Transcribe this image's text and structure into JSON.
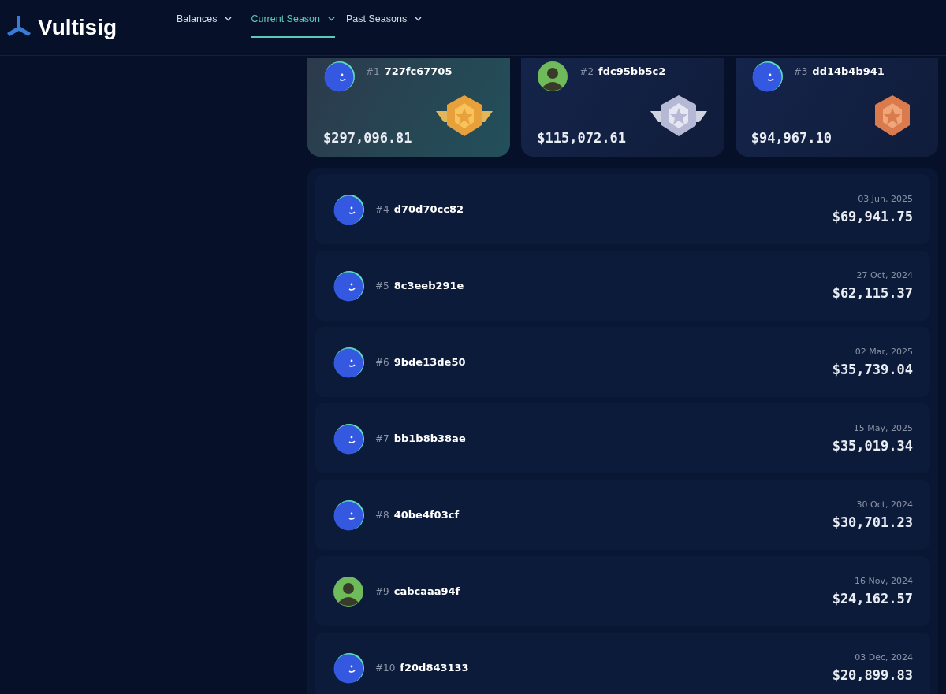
{
  "brand": {
    "name": "Vultisig"
  },
  "nav": [
    {
      "label": "Balances",
      "selected": false
    },
    {
      "label": "Current Season",
      "selected": true
    },
    {
      "label": "Past Seasons",
      "selected": false
    }
  ],
  "podium": [
    {
      "rank": "#1",
      "name": "727fc67705",
      "amount": "$297,096.81",
      "avatar": {
        "kind": "smiley"
      },
      "medal": {
        "kind": "gold"
      }
    },
    {
      "rank": "#2",
      "name": "fdc95bb5c2",
      "amount": "$115,072.61",
      "avatar": {
        "kind": "person"
      },
      "medal": {
        "kind": "silver"
      }
    },
    {
      "rank": "#3",
      "name": "dd14b4b941",
      "amount": "$94,967.10",
      "avatar": {
        "kind": "smiley"
      },
      "medal": {
        "kind": "bronze"
      }
    }
  ],
  "leaderboard": [
    {
      "rank": "#4",
      "name": "d70d70cc82",
      "date": "03 Jun, 2025",
      "amount": "$69,941.75",
      "avatar": {
        "kind": "smiley"
      }
    },
    {
      "rank": "#5",
      "name": "8c3eeb291e",
      "date": "27 Oct, 2024",
      "amount": "$62,115.37",
      "avatar": {
        "kind": "smiley"
      }
    },
    {
      "rank": "#6",
      "name": "9bde13de50",
      "date": "02 Mar, 2025",
      "amount": "$35,739.04",
      "avatar": {
        "kind": "smiley"
      }
    },
    {
      "rank": "#7",
      "name": "bb1b8b38ae",
      "date": "15 May, 2025",
      "amount": "$35,019.34",
      "avatar": {
        "kind": "smiley"
      }
    },
    {
      "rank": "#8",
      "name": "40be4f03cf",
      "date": "30 Oct, 2024",
      "amount": "$30,701.23",
      "avatar": {
        "kind": "smiley"
      }
    },
    {
      "rank": "#9",
      "name": "cabcaaa94f",
      "date": "16 Nov, 2024",
      "amount": "$24,162.57",
      "avatar": {
        "kind": "person"
      }
    },
    {
      "rank": "#10",
      "name": "f20d843133",
      "date": "03 Dec, 2024",
      "amount": "$20,899.83",
      "avatar": {
        "kind": "smiley"
      }
    }
  ]
}
